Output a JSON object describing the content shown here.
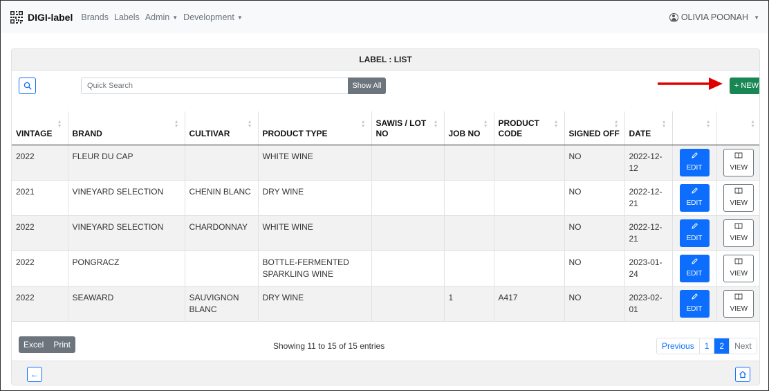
{
  "navbar": {
    "brand": "DIGI-label",
    "links": [
      "Brands",
      "Labels",
      "Admin",
      "Development"
    ],
    "user": "OLIVIA POONAH"
  },
  "card": {
    "title": "LABEL : LIST"
  },
  "toolbar": {
    "search_placeholder": "Quick Search",
    "show_all": "Show All",
    "new_button": "+ NEW",
    "arrow_color": "#e00000"
  },
  "table": {
    "headers": [
      "VINTAGE",
      "BRAND",
      "CULTIVAR",
      "PRODUCT TYPE",
      "SAWIS / LOT NO",
      "JOB NO",
      "PRODUCT CODE",
      "SIGNED OFF",
      "DATE"
    ],
    "rows": [
      [
        "2022",
        "FLEUR DU CAP",
        "",
        "WHITE WINE",
        "",
        "",
        "",
        "NO",
        "2022-12-12"
      ],
      [
        "2021",
        "VINEYARD SELECTION",
        "CHENIN BLANC",
        "DRY WINE",
        "",
        "",
        "",
        "NO",
        "2022-12-21"
      ],
      [
        "2022",
        "VINEYARD SELECTION",
        "CHARDONNAY",
        "WHITE WINE",
        "",
        "",
        "",
        "NO",
        "2022-12-21"
      ],
      [
        "2022",
        "PONGRACZ",
        "",
        "BOTTLE-FERMENTED SPARKLING WINE",
        "",
        "",
        "",
        "NO",
        "2023-01-24"
      ],
      [
        "2022",
        "SEAWARD",
        "SAUVIGNON BLANC",
        "DRY WINE",
        "",
        "1",
        "A417",
        "NO",
        "2023-02-01"
      ]
    ],
    "edit_label": "EDIT",
    "view_label": "VIEW"
  },
  "footer": {
    "export": [
      "Excel",
      "Print"
    ],
    "info": "Showing 11 to 15 of 15 entries",
    "pagination": [
      "Previous",
      "1",
      "2",
      "Next"
    ],
    "active_page": "2"
  },
  "icons": {
    "search": "search-icon",
    "edit": "pencil-icon",
    "view": "book-icon",
    "back": "arrow-left-icon",
    "home": "home-icon",
    "user": "user-circle-icon"
  }
}
